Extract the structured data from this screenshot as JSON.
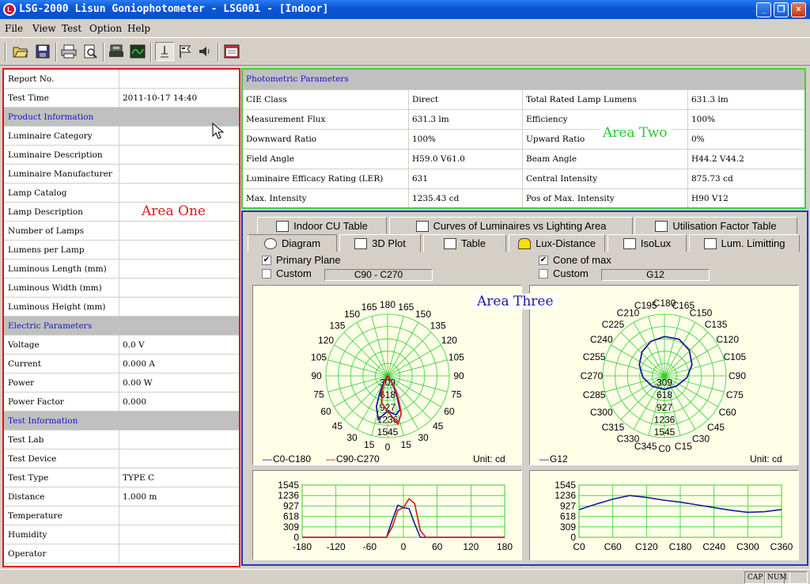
{
  "window": {
    "title": "LSG-2000 Lisun Goniophotometer - LSG001 - [Indoor]",
    "minimize": "_",
    "restore": "❐",
    "close": "×"
  },
  "menu": {
    "file": "File",
    "view": "View",
    "test": "Test",
    "option": "Option",
    "help": "Help"
  },
  "area_one": {
    "overlay_label": "Area One",
    "rows": [
      {
        "label": "Report No.",
        "value": ""
      },
      {
        "label": "Test Time",
        "value": "2011-10-17 14:40"
      },
      {
        "label": "Product Information",
        "section": true
      },
      {
        "label": "Luminaire Category",
        "value": ""
      },
      {
        "label": "Luminaire Description",
        "value": ""
      },
      {
        "label": "Luminaire Manufacturer",
        "value": ""
      },
      {
        "label": "Lamp Catalog",
        "value": ""
      },
      {
        "label": "Lamp Description",
        "value": ""
      },
      {
        "label": "Number of Lamps",
        "value": ""
      },
      {
        "label": "Lumens per Lamp",
        "value": ""
      },
      {
        "label": "Luminous Length (mm)",
        "value": ""
      },
      {
        "label": "Luminous Width (mm)",
        "value": ""
      },
      {
        "label": "Luminous Height (mm)",
        "value": ""
      },
      {
        "label": "Electric Parameters",
        "section": true
      },
      {
        "label": "Voltage",
        "value": "0.0 V"
      },
      {
        "label": "Current",
        "value": "0.000 A"
      },
      {
        "label": "Power",
        "value": "0.00 W"
      },
      {
        "label": "Power Factor",
        "value": "0.000"
      },
      {
        "label": "Test Information",
        "section": true
      },
      {
        "label": "Test Lab",
        "value": ""
      },
      {
        "label": "Test Device",
        "value": ""
      },
      {
        "label": "Test Type",
        "value": "TYPE C"
      },
      {
        "label": "Distance",
        "value": "1.000 m"
      },
      {
        "label": "Temperature",
        "value": ""
      },
      {
        "label": "Humidity",
        "value": ""
      },
      {
        "label": "Operator",
        "value": ""
      }
    ]
  },
  "area_two": {
    "overlay_label": "Area Two",
    "header": "Photometric Parameters",
    "rows": [
      [
        "CIE Class",
        "Direct",
        "Total Rated Lamp Lumens",
        "631.3 lm"
      ],
      [
        "Measurement Flux",
        "631.3 lm",
        "Efficiency",
        "100%"
      ],
      [
        "Downward Ratio",
        "100%",
        "Upward Ratio",
        "0%"
      ],
      [
        "Field Angle",
        "H59.0 V61.0",
        "Beam Angle",
        "H44.2 V44.2"
      ],
      [
        "Luminaire Efficacy Rating (LER)",
        "631",
        "Central Intensity",
        "875.73 cd"
      ],
      [
        "Max. Intensity",
        "1235.43 cd",
        "Pos of Max. Intensity",
        "H90 V12"
      ]
    ]
  },
  "area_three": {
    "overlay_label": "Area Three",
    "tabs_row1": [
      "Indoor CU Table",
      "Curves of Luminaires vs Lighting Area",
      "Utilisation Factor Table"
    ],
    "tabs_row2": [
      "Diagram",
      "3D Plot",
      "Table",
      "Lux-Distance",
      "IsoLux",
      "Lum. Limitting"
    ],
    "left_controls": {
      "primary_plane": "Primary Plane",
      "custom": "Custom",
      "combo": "C90 - C270"
    },
    "right_controls": {
      "cone_of_max": "Cone of max",
      "custom": "Custom",
      "combo": "G12"
    },
    "left_polar": {
      "legend1": "C0-C180",
      "legend2": "C90-C270",
      "unit": "Unit: cd"
    },
    "right_polar": {
      "legend1": "G12",
      "unit": "Unit: cd"
    },
    "colors": {
      "grid": "#2fcf2f",
      "series1": "#1a1aa0",
      "series2": "#d81818"
    }
  },
  "chart_data": [
    {
      "type": "polar",
      "radial_ticks": [
        309,
        618,
        927,
        1236,
        1545
      ],
      "angle_labels_left": [
        "0",
        "15",
        "30",
        "45",
        "60",
        "75",
        "90",
        "105",
        "120",
        "135",
        "150",
        "165",
        "180"
      ],
      "angle_labels_right": [
        "15",
        "30",
        "45",
        "60",
        "75",
        "90",
        "105",
        "120",
        "135",
        "150",
        "165"
      ],
      "series": [
        {
          "name": "C0-C180",
          "gamma": [
            0,
            12,
            20,
            24,
            30,
            34,
            40,
            50
          ],
          "left": [
            876,
            1120,
            820,
            500,
            200,
            80,
            20,
            0
          ],
          "right": [
            876,
            1000,
            900,
            600,
            300,
            100,
            20,
            0
          ]
        },
        {
          "name": "C90-C270",
          "gamma": [
            0,
            12,
            20,
            24,
            30,
            34,
            40,
            50
          ],
          "left": [
            876,
            700,
            400,
            250,
            150,
            60,
            10,
            0
          ],
          "right": [
            876,
            1235,
            1000,
            700,
            400,
            150,
            30,
            0
          ]
        }
      ]
    },
    {
      "type": "polar",
      "radial_ticks": [
        309,
        618,
        927,
        1236,
        1545
      ],
      "angle_labels": [
        "C0",
        "C15",
        "C30",
        "C45",
        "C60",
        "C75",
        "C90",
        "C105",
        "C120",
        "C135",
        "C150",
        "C165",
        "C180",
        "C195",
        "C210",
        "C225",
        "C240",
        "C255",
        "C270",
        "C285",
        "C300",
        "C315",
        "C330",
        "C345"
      ],
      "series": [
        {
          "name": "G12",
          "c": [
            0,
            30,
            60,
            90,
            120,
            150,
            180,
            210,
            240,
            270,
            300,
            330,
            360
          ],
          "values": [
            1030,
            1020,
            1080,
            1150,
            1200,
            1230,
            1180,
            1130,
            1080,
            1050,
            1040,
            1030,
            1030
          ]
        }
      ]
    },
    {
      "type": "line",
      "x": [
        -180,
        -120,
        -60,
        -30,
        -20,
        -10,
        0,
        10,
        20,
        30,
        40,
        50,
        60,
        120,
        180
      ],
      "xticks": [
        "-180",
        "-120",
        "-60",
        "0",
        "60",
        "120",
        "180"
      ],
      "yticks": [
        "0",
        "309",
        "618",
        "927",
        "1236",
        "1545"
      ],
      "ylim": [
        0,
        1545
      ],
      "series": [
        {
          "name": "C0-C180",
          "values": [
            0,
            0,
            0,
            0,
            500,
            950,
            876,
            850,
            400,
            0,
            0,
            0,
            0,
            0,
            0
          ]
        },
        {
          "name": "C90-C270",
          "values": [
            0,
            0,
            0,
            0,
            300,
            800,
            876,
            1140,
            1000,
            200,
            0,
            0,
            0,
            0,
            0
          ]
        }
      ]
    },
    {
      "type": "line",
      "x": [
        0,
        30,
        60,
        90,
        120,
        150,
        180,
        210,
        240,
        270,
        300,
        330,
        360
      ],
      "xticks": [
        "C0",
        "C60",
        "C120",
        "C180",
        "C240",
        "C300",
        "C360"
      ],
      "yticks": [
        "0",
        "309",
        "618",
        "927",
        "1236",
        "1545"
      ],
      "ylim": [
        0,
        1545
      ],
      "series": [
        {
          "name": "G12",
          "values": [
            820,
            980,
            1130,
            1235,
            1180,
            1100,
            1040,
            960,
            880,
            800,
            740,
            760,
            820
          ]
        }
      ]
    }
  ],
  "statusbar": {
    "cap": "CAP",
    "num": "NUM"
  }
}
